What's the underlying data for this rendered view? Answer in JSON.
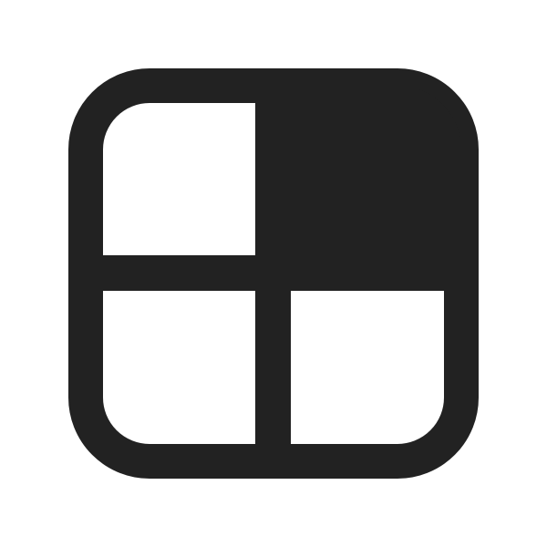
{
  "icon": {
    "name": "grid-quadrant-top-right-filled-icon",
    "color": "#222222",
    "background": "#ffffff"
  }
}
